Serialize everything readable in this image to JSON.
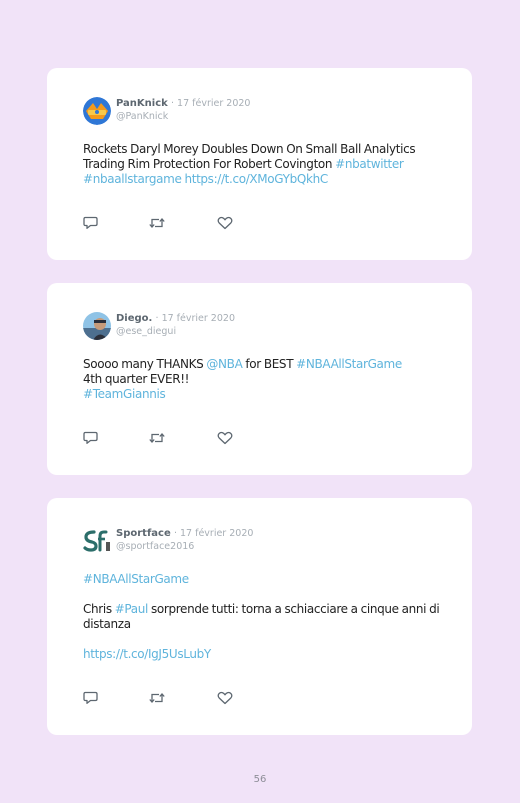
{
  "page": {
    "background": "#f1e3f8",
    "number": "56"
  },
  "colors": {
    "link": "#5fb4dc",
    "name": "#5d6770",
    "muted": "#a7aeb5",
    "text": "#222222",
    "card": "#ffffff"
  },
  "tweets": [
    {
      "name": "PanKnick",
      "date": "· 17 février 2020",
      "handle": "@PanKnick",
      "avatar": "panknick-logo-avatar",
      "text_line1": "Rockets Daryl Morey Doubles Down On Small Ball Analytics Trading Rim Protection For Robert Covington",
      "hashtag1": "#nbatwitter",
      "hashtag2": "#nbaallstargame",
      "link": "https://t.co/XMoGYbQkhC",
      "actions": [
        "reply-icon",
        "retweet-icon",
        "like-icon"
      ]
    },
    {
      "name": "Diego.",
      "date": "· 17 février 2020",
      "handle": "@ese_diegui",
      "avatar": "diego-photo-avatar",
      "text_part1": "Soooo many THANKS ",
      "mention": "@NBA",
      "text_part2": " for BEST ",
      "hashtag1": "#NBAAllStarGame",
      "text_part3": "4th quarter EVER!!",
      "hashtag2": "#TeamGiannis",
      "actions": [
        "reply-icon",
        "retweet-icon",
        "like-icon"
      ]
    },
    {
      "name": "Sportface",
      "date": "· 17 février 2020",
      "handle": "@sportface2016",
      "avatar": "sportface-logo-avatar",
      "hashtag1": "#NBAAllStarGame",
      "text_part1": "Chris ",
      "hashtag2": "#Paul",
      "text_part2": " sorprende tutti: torna a schiacciare a cinque anni di distanza",
      "link": "https://t.co/IgJ5UsLubY",
      "actions": [
        "reply-icon",
        "retweet-icon",
        "like-icon"
      ]
    }
  ]
}
